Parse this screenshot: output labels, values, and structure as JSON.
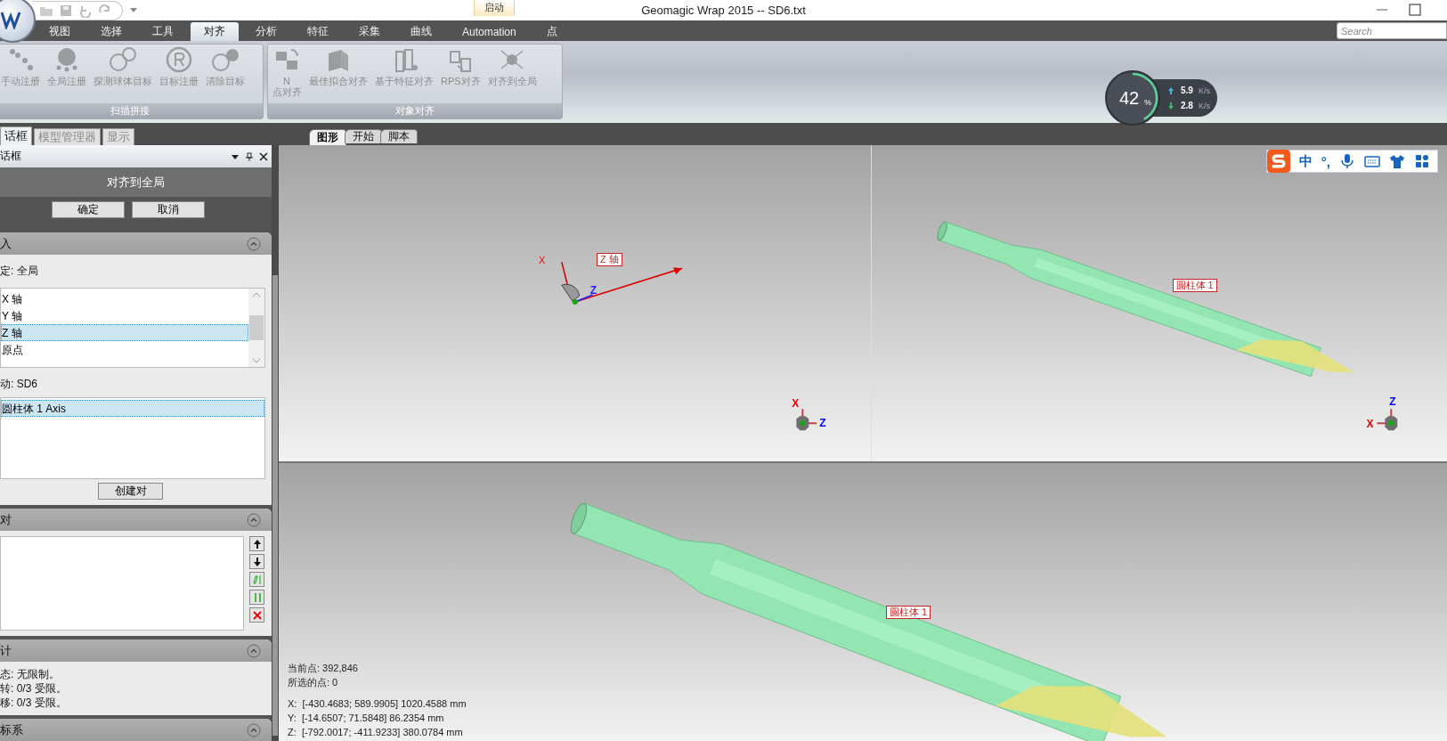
{
  "window": {
    "title": "Geomagic Wrap 2015 -- SD6.txt",
    "context_tab": "启动"
  },
  "ribbon_tabs": [
    {
      "label": "视图",
      "selected": false
    },
    {
      "label": "选择",
      "selected": false
    },
    {
      "label": "工具",
      "selected": false
    },
    {
      "label": "对齐",
      "selected": true
    },
    {
      "label": "分析",
      "selected": false
    },
    {
      "label": "特征",
      "selected": false
    },
    {
      "label": "采集",
      "selected": false
    },
    {
      "label": "曲线",
      "selected": false
    },
    {
      "label": "Automation",
      "selected": false
    },
    {
      "label": "点",
      "selected": false
    }
  ],
  "search": {
    "placeholder": "Search"
  },
  "ribbon_groups": [
    {
      "label": "扫描拼接",
      "buttons": [
        {
          "label": "手动注册",
          "disabled": true
        },
        {
          "label": "全局注册",
          "disabled": true
        },
        {
          "label": "探测球体目标",
          "disabled": true
        },
        {
          "label": "目标注册",
          "disabled": true
        },
        {
          "label": "清除目标",
          "disabled": true
        }
      ]
    },
    {
      "label": "对象对齐",
      "buttons": [
        {
          "label": "N\n点对齐",
          "disabled": true
        },
        {
          "label": "最佳拟合对齐",
          "disabled": true
        },
        {
          "label": "基于特征对齐",
          "disabled": true
        },
        {
          "label": "RPS对齐",
          "disabled": true
        },
        {
          "label": "对齐到全局",
          "disabled": true
        }
      ]
    }
  ],
  "net_monitor": {
    "percent": "42",
    "percent_unit": "%",
    "level": 0.42,
    "upload": {
      "value": "5.9",
      "unit": "K/s"
    },
    "download": {
      "value": "2.8",
      "unit": "K/s"
    }
  },
  "panel_tabs": [
    {
      "label": "话框",
      "selected": true
    },
    {
      "label": "模型管理器",
      "selected": false
    },
    {
      "label": "显示",
      "selected": false
    }
  ],
  "doc_tabs": [
    {
      "label": "图形",
      "selected": true
    },
    {
      "label": "开始",
      "selected": false
    },
    {
      "label": "脚本",
      "selected": false
    }
  ],
  "dialog": {
    "header": "话框",
    "title": "对齐到全局",
    "buttons": [
      "确定",
      "取消"
    ],
    "sections": [
      {
        "kind": "input",
        "title": "入",
        "expanded": true,
        "fixed_label": "定: 全局",
        "fixed_items": [
          {
            "label": "X 轴",
            "selected": false
          },
          {
            "label": "Y 轴",
            "selected": false
          },
          {
            "label": "Z 轴",
            "selected": true
          },
          {
            "label": "原点",
            "selected": false
          }
        ],
        "floating_label": "动: SD6",
        "floating_items": [
          {
            "label": "圆柱体 1 Axis",
            "selected": true
          }
        ],
        "action": "创建对"
      },
      {
        "kind": "pairs",
        "title": "对",
        "expanded": true
      },
      {
        "kind": "stats",
        "title": "计",
        "expanded": true,
        "lines": [
          "态: 无限制。",
          "转: 0/3 受限。",
          "移: 0/3 受限。"
        ]
      },
      {
        "kind": "coords",
        "title": "标系",
        "expanded": true
      }
    ]
  },
  "viewport": {
    "top_left": {
      "axis_label": "Z 轴",
      "big_triad": [
        "X",
        "Z"
      ],
      "small_triad": [
        "X",
        "Z"
      ]
    },
    "top_right": {
      "cylinder_label": "圆柱体 1",
      "small_triad": [
        "Z",
        "X"
      ]
    },
    "bottom": {
      "cylinder_label": "圆柱体 1",
      "info": [
        "当前点: 392,846",
        "所选的点: 0"
      ],
      "bounds": [
        "X:  [-430.4683; 589.9905] 1020.4588 mm",
        "Y:  [-14.6507; 71.5848] 86.2354 mm",
        "Z:  [-792.0017; -411.9233] 380.0784 mm"
      ]
    }
  },
  "ime_bar": {
    "items": [
      {
        "kind": "logo"
      },
      {
        "kind": "text",
        "label": "中"
      },
      {
        "kind": "text",
        "label": "°,"
      },
      {
        "kind": "mic"
      },
      {
        "kind": "keyboard"
      },
      {
        "kind": "shirt"
      },
      {
        "kind": "grid"
      }
    ]
  }
}
